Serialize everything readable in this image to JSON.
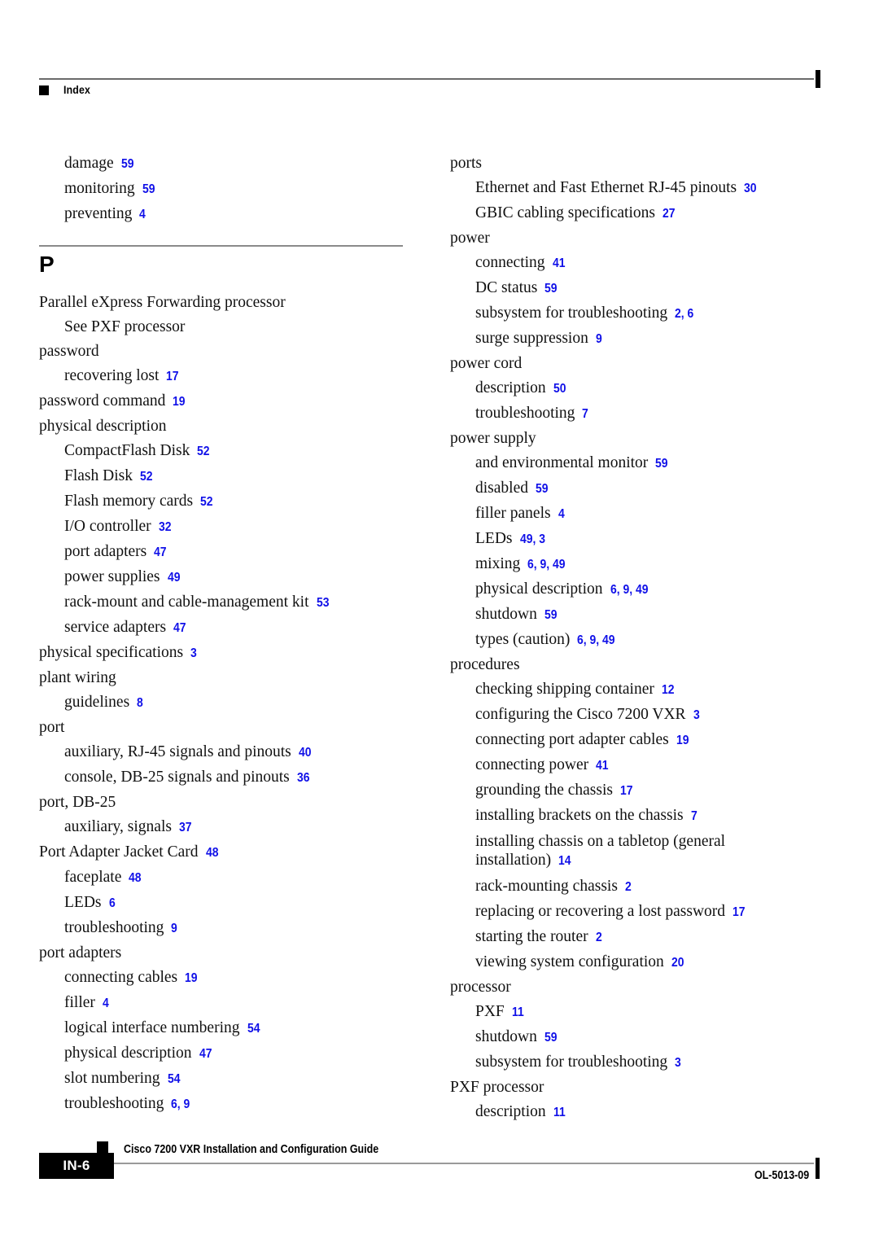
{
  "header": {
    "label": "Index",
    "marker_icon": "black-square-icon"
  },
  "section": {
    "letter": "P"
  },
  "left_column": {
    "pre_entries": [
      {
        "level": 1,
        "term": "damage",
        "pages": "59"
      },
      {
        "level": 1,
        "term": "monitoring",
        "pages": "59"
      },
      {
        "level": 1,
        "term": "preventing",
        "pages": "4"
      }
    ],
    "entries": [
      {
        "level": 0,
        "term": "Parallel eXpress Forwarding processor",
        "pages": ""
      },
      {
        "level": 1,
        "term": "See PXF processor",
        "pages": ""
      },
      {
        "level": 0,
        "term": "password",
        "pages": ""
      },
      {
        "level": 1,
        "term": "recovering lost",
        "pages": "17"
      },
      {
        "level": 0,
        "term": "password command",
        "pages": "19"
      },
      {
        "level": 0,
        "term": "physical description",
        "pages": ""
      },
      {
        "level": 1,
        "term": "CompactFlash Disk",
        "pages": "52"
      },
      {
        "level": 1,
        "term": "Flash Disk",
        "pages": "52"
      },
      {
        "level": 1,
        "term": "Flash memory cards",
        "pages": "52"
      },
      {
        "level": 1,
        "term": "I/O controller",
        "pages": "32"
      },
      {
        "level": 1,
        "term": "port adapters",
        "pages": "47"
      },
      {
        "level": 1,
        "term": "power supplies",
        "pages": "49"
      },
      {
        "level": 1,
        "term": "rack-mount and cable-management kit",
        "pages": "53"
      },
      {
        "level": 1,
        "term": "service adapters",
        "pages": "47"
      },
      {
        "level": 0,
        "term": "physical specifications",
        "pages": "3"
      },
      {
        "level": 0,
        "term": "plant wiring",
        "pages": ""
      },
      {
        "level": 1,
        "term": "guidelines",
        "pages": "8"
      },
      {
        "level": 0,
        "term": "port",
        "pages": ""
      },
      {
        "level": 1,
        "term": "auxiliary, RJ-45 signals and pinouts",
        "pages": "40"
      },
      {
        "level": 1,
        "term": "console, DB-25 signals and pinouts",
        "pages": "36"
      },
      {
        "level": 0,
        "term": "port, DB-25",
        "pages": ""
      },
      {
        "level": 1,
        "term": "auxiliary, signals",
        "pages": "37"
      },
      {
        "level": 0,
        "term": "Port Adapter Jacket Card",
        "pages": "48"
      },
      {
        "level": 1,
        "term": "faceplate",
        "pages": "48"
      },
      {
        "level": 1,
        "term": "LEDs",
        "pages": "6"
      },
      {
        "level": 1,
        "term": "troubleshooting",
        "pages": "9"
      },
      {
        "level": 0,
        "term": "port adapters",
        "pages": ""
      },
      {
        "level": 1,
        "term": "connecting cables",
        "pages": "19"
      },
      {
        "level": 1,
        "term": "filler",
        "pages": "4"
      },
      {
        "level": 1,
        "term": "logical interface numbering",
        "pages": "54"
      },
      {
        "level": 1,
        "term": "physical description",
        "pages": "47"
      },
      {
        "level": 1,
        "term": "slot numbering",
        "pages": "54"
      },
      {
        "level": 1,
        "term": "troubleshooting",
        "pages": "6, 9"
      }
    ]
  },
  "right_column": {
    "entries": [
      {
        "level": 0,
        "term": "ports",
        "pages": ""
      },
      {
        "level": 1,
        "term": "Ethernet and Fast Ethernet RJ-45 pinouts",
        "pages": "30"
      },
      {
        "level": 1,
        "term": "GBIC cabling specifications",
        "pages": "27"
      },
      {
        "level": 0,
        "term": "power",
        "pages": ""
      },
      {
        "level": 1,
        "term": "connecting",
        "pages": "41"
      },
      {
        "level": 1,
        "term": "DC status",
        "pages": "59"
      },
      {
        "level": 1,
        "term": "subsystem for troubleshooting",
        "pages": "2, 6"
      },
      {
        "level": 1,
        "term": "surge suppression",
        "pages": "9"
      },
      {
        "level": 0,
        "term": "power cord",
        "pages": ""
      },
      {
        "level": 1,
        "term": "description",
        "pages": "50"
      },
      {
        "level": 1,
        "term": "troubleshooting",
        "pages": "7"
      },
      {
        "level": 0,
        "term": "power supply",
        "pages": ""
      },
      {
        "level": 1,
        "term": "and environmental monitor",
        "pages": "59"
      },
      {
        "level": 1,
        "term": "disabled",
        "pages": "59"
      },
      {
        "level": 1,
        "term": "filler panels",
        "pages": "4"
      },
      {
        "level": 1,
        "term": "LEDs",
        "pages": "49, 3"
      },
      {
        "level": 1,
        "term": "mixing",
        "pages": "6, 9, 49"
      },
      {
        "level": 1,
        "term": "physical description",
        "pages": "6, 9, 49"
      },
      {
        "level": 1,
        "term": "shutdown",
        "pages": "59"
      },
      {
        "level": 1,
        "term": "types (caution)",
        "pages": "6, 9, 49"
      },
      {
        "level": 0,
        "term": "procedures",
        "pages": ""
      },
      {
        "level": 1,
        "term": "checking shipping container",
        "pages": "12"
      },
      {
        "level": 1,
        "term": "configuring the Cisco 7200 VXR",
        "pages": "3"
      },
      {
        "level": 1,
        "term": "connecting port adapter cables",
        "pages": "19"
      },
      {
        "level": 1,
        "term": "connecting power",
        "pages": "41"
      },
      {
        "level": 1,
        "term": "grounding the chassis",
        "pages": "17"
      },
      {
        "level": 1,
        "term": "installing brackets on the chassis",
        "pages": "7"
      },
      {
        "level": 1,
        "term": "installing chassis on a tabletop (general installation)",
        "pages": "14",
        "wrap": true
      },
      {
        "level": 1,
        "term": "rack-mounting chassis",
        "pages": "2"
      },
      {
        "level": 1,
        "term": "replacing or recovering a lost password",
        "pages": "17"
      },
      {
        "level": 1,
        "term": "starting the router",
        "pages": "2"
      },
      {
        "level": 1,
        "term": "viewing system configuration",
        "pages": "20"
      },
      {
        "level": 0,
        "term": "processor",
        "pages": ""
      },
      {
        "level": 1,
        "term": "PXF",
        "pages": "11"
      },
      {
        "level": 1,
        "term": "shutdown",
        "pages": "59"
      },
      {
        "level": 1,
        "term": "subsystem for troubleshooting",
        "pages": "3"
      },
      {
        "level": 0,
        "term": "PXF processor",
        "pages": ""
      },
      {
        "level": 1,
        "term": "description",
        "pages": "11"
      }
    ]
  },
  "footer": {
    "page_tab": "IN-6",
    "book_title": "Cisco 7200 VXR Installation and Configuration Guide",
    "doc_id": "OL-5013-09",
    "marker_icon": "black-square-icon"
  },
  "colors": {
    "page_number_blue": "#1010e8",
    "rule_gray": "#8a8a8a",
    "text_black": "#111111"
  }
}
